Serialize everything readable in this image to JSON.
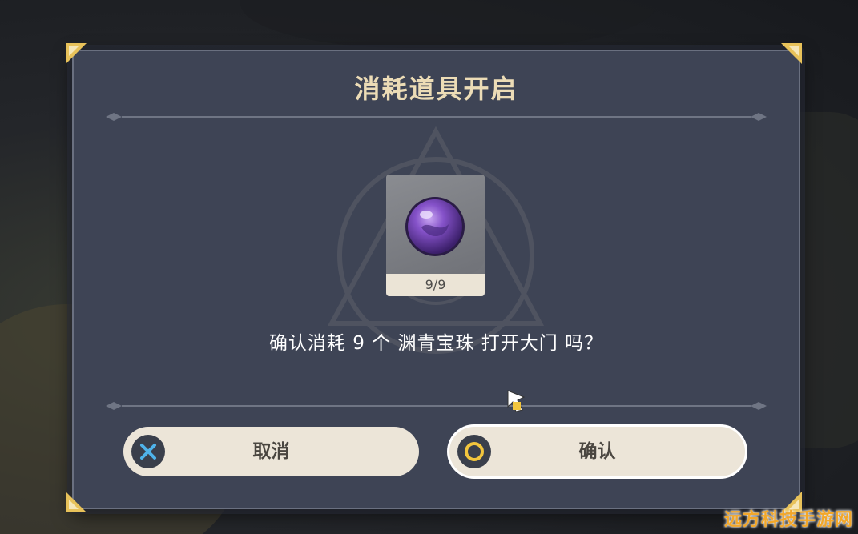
{
  "dialog": {
    "title": "消耗道具开启",
    "message": "确认消耗 9 个 渊青宝珠 打开大门 吗？"
  },
  "item": {
    "icon": "purple-orb-icon",
    "count": "9/9"
  },
  "buttons": {
    "cancel_label": "取消",
    "cancel_icon": "x-icon",
    "confirm_label": "确认",
    "confirm_icon": "circle-icon"
  },
  "watermark": "远方科技手游网",
  "colors": {
    "title": "#ecdcb6",
    "panel": "#3e4455",
    "button": "#ece5d8",
    "accent_gold": "#e8c25a",
    "orb": "#7b4fc0"
  }
}
